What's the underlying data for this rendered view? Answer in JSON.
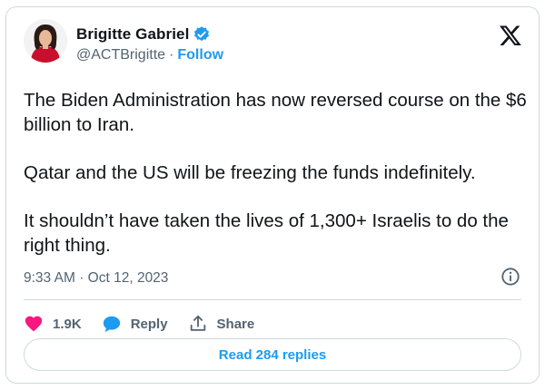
{
  "author": {
    "name": "Brigitte Gabriel",
    "handle": "@ACTBrigitte",
    "separator": "·",
    "follow_label": "Follow"
  },
  "tweet": {
    "paragraphs": [
      "The Biden Administration has now reversed course on the $6 billion to Iran.",
      "Qatar and the US will be freezing the funds indefinitely.",
      "It shouldn’t have taken the lives of 1,300+ Israelis to do the right thing."
    ],
    "time": "9:33 AM",
    "date_separator": "·",
    "date": "Oct 12, 2023"
  },
  "actions": {
    "likes": "1.9K",
    "reply_label": "Reply",
    "share_label": "Share"
  },
  "read_replies_label": "Read 284 replies",
  "icons": {
    "verified": "verified-badge-icon",
    "brand": "x-logo-icon",
    "info": "info-icon",
    "like": "heart-icon",
    "reply": "speech-bubble-icon",
    "share": "share-upload-icon"
  },
  "colors": {
    "accent": "#1d9bf0",
    "like": "#f91880",
    "text": "#0f1419",
    "muted": "#536471",
    "border": "#cfd9de"
  }
}
